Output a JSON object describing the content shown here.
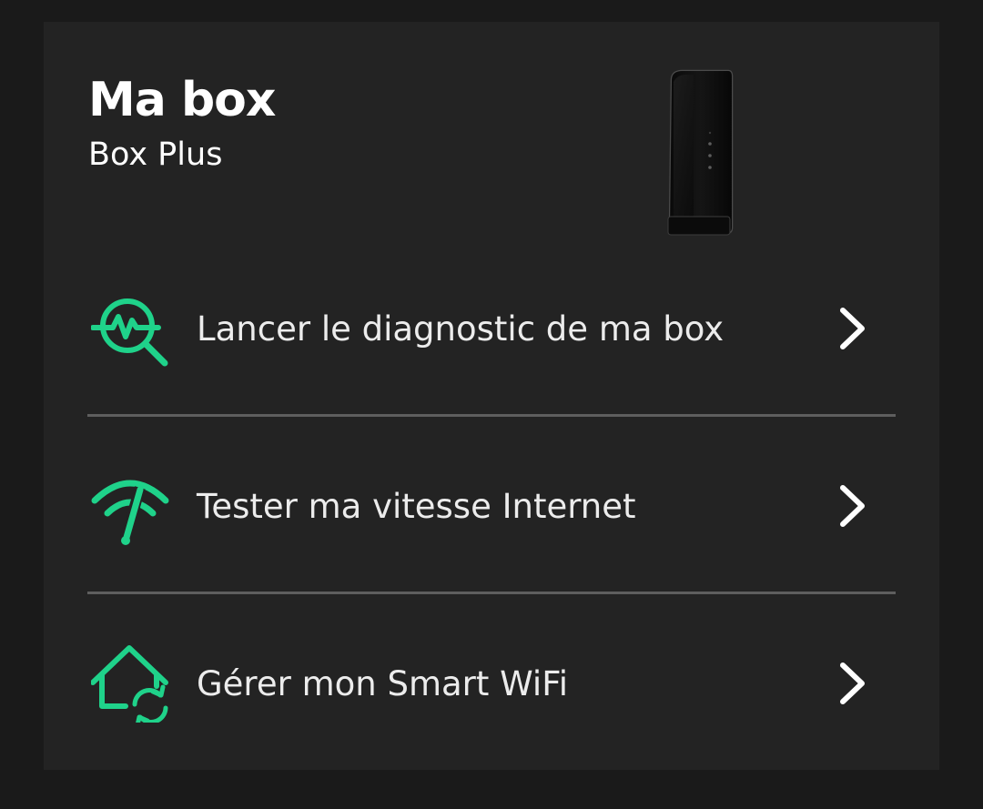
{
  "header": {
    "title": "Ma box",
    "subtitle": "Box Plus"
  },
  "device": {
    "image": "box-router-image"
  },
  "actions": [
    {
      "label": "Lancer le diagnostic de ma box",
      "icon": "diagnostic-search-icon"
    },
    {
      "label": "Tester ma vitesse Internet",
      "icon": "wifi-speed-icon"
    },
    {
      "label": "Gérer mon Smart WiFi",
      "icon": "smart-wifi-home-icon"
    }
  ],
  "colors": {
    "accent": "#1fd28a",
    "card_background": "#232323",
    "page_background": "#1a1a1a",
    "text": "#ffffff",
    "divider": "#5e5e5e"
  }
}
